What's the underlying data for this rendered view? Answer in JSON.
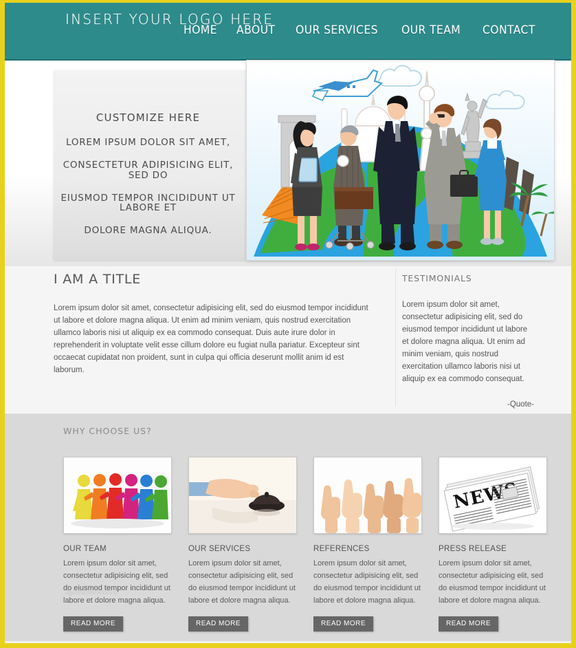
{
  "theme": {
    "frame_color": "#e8d11c",
    "header_bg": "#2e8b8b",
    "content_bg": "#f5f5f5",
    "features_bg": "#d9d9d9",
    "button_bg": "#666666",
    "text_color": "#555555"
  },
  "header": {
    "logo": "INSERT YOUR LOGO HERE",
    "nav": [
      {
        "label": "HOME"
      },
      {
        "label": "ABOUT"
      },
      {
        "label": "OUR SERVICES"
      },
      {
        "label": "OUR TEAM"
      },
      {
        "label": "CONTACT"
      }
    ]
  },
  "hero": {
    "title": "CUSTOMIZE HERE",
    "lines": [
      "LOREM IPSUM DOLOR SIT AMET,",
      "CONSECTETUR ADIPISICING ELIT, SED DO",
      "EIUSMOD TEMPOR INCIDIDUNT UT LABORE ET",
      "DOLORE MAGNA ALIQUA."
    ],
    "image_alt": "business-travel-globe-illustration"
  },
  "content": {
    "title": "I AM A TITLE",
    "body": "Lorem ipsum dolor sit amet, consectetur adipisicing elit, sed do eiusmod tempor incididunt ut labore et dolore magna aliqua. Ut enim ad minim veniam, quis nostrud exercitation ullamco laboris nisi ut aliquip ex ea commodo consequat. Duis aute irure dolor in reprehenderit in voluptate velit esse cillum dolore eu fugiat nulla pariatur. Excepteur sint occaecat cupidatat non proident, sunt in culpa qui officia deserunt mollit anim id est laborum."
  },
  "testimonials": {
    "title": "TESTIMONIALS",
    "body": "Lorem ipsum dolor sit amet, consectetur adipisicing elit, sed do eiusmod tempor incididunt ut labore et dolore magna aliqua. Ut enim ad minim veniam, quis nostrud exercitation ullamco laboris nisi ut aliquip ex ea commodo consequat.",
    "quote_attribution": "-Quote-"
  },
  "features": {
    "title": "WHY CHOOSE US?",
    "ghost_text": "agesthinsterances d",
    "cards": [
      {
        "image_alt": "colorful-team-figures",
        "title": "OUR TEAM",
        "body": "Lorem ipsum dolor sit amet, consectetur adipisicing elit, sed do eiusmod tempor incididunt ut labore et dolore magna aliqua.",
        "button": "READ MORE"
      },
      {
        "image_alt": "hand-pressing-service-bell",
        "title": "OUR SERVICES",
        "body": "Lorem ipsum dolor sit amet, consectetur adipisicing elit, sed do eiusmod tempor incididunt ut labore et dolore magna aliqua.",
        "button": "READ MORE"
      },
      {
        "image_alt": "thumbs-up-hands",
        "title": "REFERENCES",
        "body": "Lorem ipsum dolor sit amet, consectetur adipisicing elit, sed do eiusmod tempor incididunt ut labore et dolore magna aliqua.",
        "button": "READ MORE"
      },
      {
        "image_alt": "folded-newspaper",
        "title": "PRESS RELEASE",
        "body": "Lorem ipsum dolor sit amet, consectetur adipisicing elit, sed do eiusmod tempor incididunt ut labore et dolore magna aliqua.",
        "button": "READ MORE"
      }
    ]
  }
}
